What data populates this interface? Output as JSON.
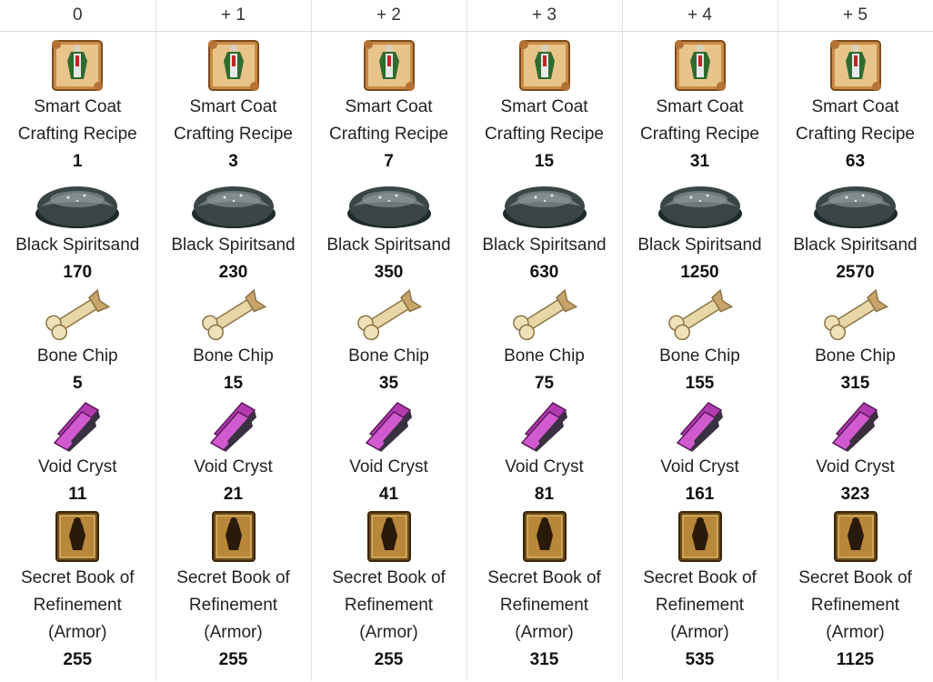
{
  "levels": [
    {
      "label": "0",
      "materials": [
        {
          "name": "Smart Coat Crafting Recipe",
          "icon": "recipe-scroll-icon",
          "qty": "1"
        },
        {
          "name": "Black Spiritsand",
          "icon": "spiritsand-icon",
          "qty": "170"
        },
        {
          "name": "Bone Chip",
          "icon": "bone-chip-icon",
          "qty": "5"
        },
        {
          "name": "Void Cryst",
          "icon": "void-cryst-icon",
          "qty": "11"
        },
        {
          "name": "Secret Book of Refinement (Armor)",
          "icon": "secret-book-icon",
          "qty": "255"
        }
      ]
    },
    {
      "label": "+ 1",
      "materials": [
        {
          "name": "Smart Coat Crafting Recipe",
          "icon": "recipe-scroll-icon",
          "qty": "3"
        },
        {
          "name": "Black Spiritsand",
          "icon": "spiritsand-icon",
          "qty": "230"
        },
        {
          "name": "Bone Chip",
          "icon": "bone-chip-icon",
          "qty": "15"
        },
        {
          "name": "Void Cryst",
          "icon": "void-cryst-icon",
          "qty": "21"
        },
        {
          "name": "Secret Book of Refinement (Armor)",
          "icon": "secret-book-icon",
          "qty": "255"
        }
      ]
    },
    {
      "label": "+ 2",
      "materials": [
        {
          "name": "Smart Coat Crafting Recipe",
          "icon": "recipe-scroll-icon",
          "qty": "7"
        },
        {
          "name": "Black Spiritsand",
          "icon": "spiritsand-icon",
          "qty": "350"
        },
        {
          "name": "Bone Chip",
          "icon": "bone-chip-icon",
          "qty": "35"
        },
        {
          "name": "Void Cryst",
          "icon": "void-cryst-icon",
          "qty": "41"
        },
        {
          "name": "Secret Book of Refinement (Armor)",
          "icon": "secret-book-icon",
          "qty": "255"
        }
      ]
    },
    {
      "label": "+ 3",
      "materials": [
        {
          "name": "Smart Coat Crafting Recipe",
          "icon": "recipe-scroll-icon",
          "qty": "15"
        },
        {
          "name": "Black Spiritsand",
          "icon": "spiritsand-icon",
          "qty": "630"
        },
        {
          "name": "Bone Chip",
          "icon": "bone-chip-icon",
          "qty": "75"
        },
        {
          "name": "Void Cryst",
          "icon": "void-cryst-icon",
          "qty": "81"
        },
        {
          "name": "Secret Book of Refinement (Armor)",
          "icon": "secret-book-icon",
          "qty": "315"
        }
      ]
    },
    {
      "label": "+ 4",
      "materials": [
        {
          "name": "Smart Coat Crafting Recipe",
          "icon": "recipe-scroll-icon",
          "qty": "31"
        },
        {
          "name": "Black Spiritsand",
          "icon": "spiritsand-icon",
          "qty": "1250"
        },
        {
          "name": "Bone Chip",
          "icon": "bone-chip-icon",
          "qty": "155"
        },
        {
          "name": "Void Cryst",
          "icon": "void-cryst-icon",
          "qty": "161"
        },
        {
          "name": "Secret Book of Refinement (Armor)",
          "icon": "secret-book-icon",
          "qty": "535"
        }
      ]
    },
    {
      "label": "+ 5",
      "materials": [
        {
          "name": "Smart Coat Crafting Recipe",
          "icon": "recipe-scroll-icon",
          "qty": "63"
        },
        {
          "name": "Black Spiritsand",
          "icon": "spiritsand-icon",
          "qty": "2570"
        },
        {
          "name": "Bone Chip",
          "icon": "bone-chip-icon",
          "qty": "315"
        },
        {
          "name": "Void Cryst",
          "icon": "void-cryst-icon",
          "qty": "323"
        },
        {
          "name": "Secret Book of Refinement (Armor)",
          "icon": "secret-book-icon",
          "qty": "1125"
        }
      ]
    }
  ]
}
